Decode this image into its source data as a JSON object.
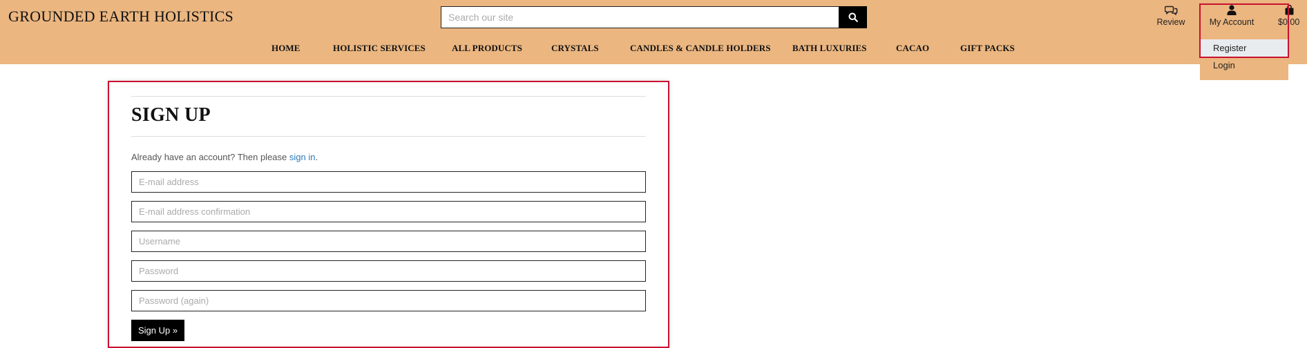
{
  "site": {
    "brand": "GROUNDED EARTH HOLISTICS"
  },
  "search": {
    "placeholder": "Search our site"
  },
  "nav": {
    "items": [
      "HOME",
      "HOLISTIC SERVICES",
      "ALL PRODUCTS",
      "CRYSTALS",
      "CANDLES & CANDLE HOLDERS",
      "BATH LUXURIES",
      "CACAO",
      "GIFT PACKS"
    ]
  },
  "header_actions": {
    "review": {
      "label": "Review",
      "icon": "chat-bubbles-icon"
    },
    "account": {
      "label": "My Account",
      "icon": "user-icon"
    },
    "cart": {
      "label": "$0.00",
      "icon": "shopping-bag-icon"
    }
  },
  "account_menu": {
    "items": [
      "Register",
      "Login"
    ],
    "active": "Register"
  },
  "signup": {
    "title": "SIGN UP",
    "intro_text": "Already have an account? Then please ",
    "intro_link": "sign in",
    "intro_end": ".",
    "fields": [
      {
        "placeholder": "E-mail address"
      },
      {
        "placeholder": "E-mail address confirmation"
      },
      {
        "placeholder": "Username"
      },
      {
        "placeholder": "Password"
      },
      {
        "placeholder": "Password (again)"
      }
    ],
    "button": "Sign Up »"
  },
  "colors": {
    "header_bg": "#ebb680",
    "highlight": "#c8102e",
    "link": "#2a7ab8"
  }
}
